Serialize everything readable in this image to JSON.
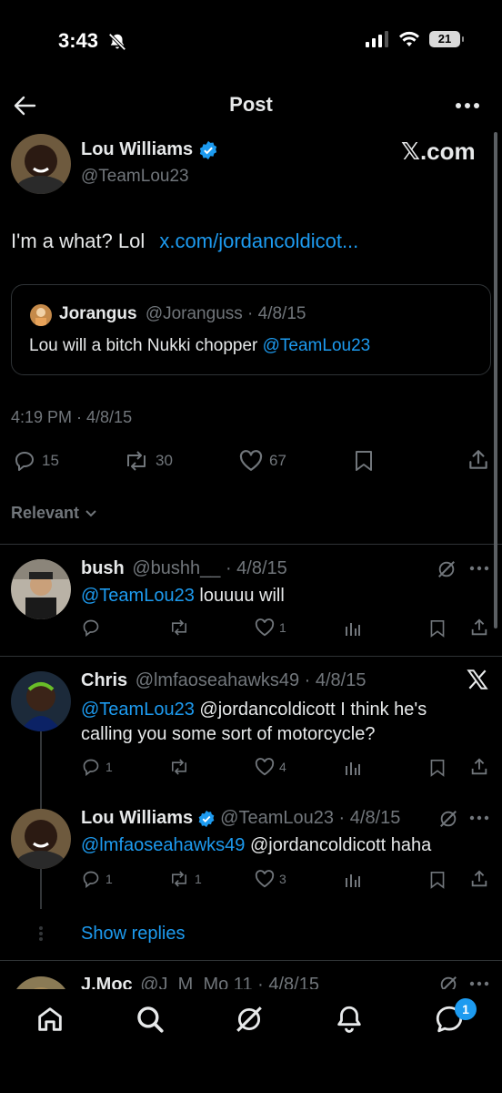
{
  "status_bar": {
    "time": "3:43",
    "battery": "21"
  },
  "header": {
    "title": "Post"
  },
  "post": {
    "author_name": "Lou Williams",
    "author_handle": "@TeamLou23",
    "watermark": "𝕏.com",
    "text": "I'm a what? Lol",
    "link": "x.com/jordancoldicot...",
    "quote": {
      "author_name": "Jorangus",
      "meta": "@Joranguss · 4/8/15",
      "text": "Lou will a bitch Nukki chopper",
      "mention": "@TeamLou23"
    },
    "timestamp": "4:19 PM · 4/8/15",
    "stats": {
      "replies": "15",
      "reposts": "30",
      "likes": "67"
    }
  },
  "sort": {
    "label": "Relevant"
  },
  "replies": [
    {
      "name": "bush",
      "meta": "@bushh__ · 4/8/15",
      "mention": "@TeamLou23",
      "text": "louuuu will",
      "likes": "1"
    },
    {
      "name": "Chris",
      "meta": "@lmfaoseahawks49 · 4/8/15",
      "mention": "@TeamLou23",
      "text": "@jordancoldicott I think he's calling you some sort of motorcycle?",
      "replies": "1",
      "likes": "4"
    },
    {
      "name": "Lou Williams",
      "meta": "@TeamLou23 · 4/8/15",
      "mention": "@lmfaoseahawks49",
      "text": "@jordancoldicott haha",
      "replies": "1",
      "reposts": "1",
      "likes": "3"
    },
    {
      "name": "J.Moc",
      "meta": "@J_M_Mo 11 · 4/8/15"
    }
  ],
  "show_replies": "Show replies",
  "nav": {
    "messages_badge": "1"
  }
}
